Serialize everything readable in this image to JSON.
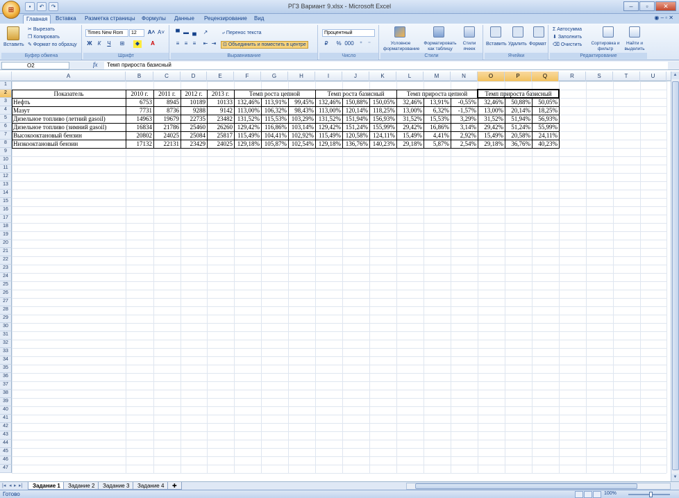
{
  "app": {
    "window_title": "РГЗ Вариант 9.xlsx - Microsoft Excel",
    "office_button_icon": "office-logo-icon",
    "qat": [
      "save-icon",
      "undo-icon",
      "redo-icon"
    ],
    "window_controls": [
      "–",
      "▫",
      "✕"
    ]
  },
  "ribbon": {
    "tabs": [
      "Главная",
      "Вставка",
      "Разметка страницы",
      "Формулы",
      "Данные",
      "Рецензирование",
      "Вид"
    ],
    "active_tab": "Главная",
    "clipboard": {
      "paste": "Вставить",
      "cut": "Вырезать",
      "copy": "Копировать",
      "format_painter": "Формат по образцу",
      "label": "Буфер обмена"
    },
    "font": {
      "name": "Times New Rom",
      "size": "12",
      "bold": "Ж",
      "italic": "К",
      "underline": "Ч",
      "label": "Шрифт"
    },
    "alignment": {
      "wrap": "Перенос текста",
      "merge": "Объединить и поместить в центре",
      "label": "Выравнивание"
    },
    "number": {
      "format": "Процентный",
      "percent": "%",
      "thousands": "000",
      "label": "Число"
    },
    "styles": {
      "conditional": "Условное форматирование",
      "as_table": "Форматировать как таблицу",
      "cell_styles": "Стили ячеек",
      "label": "Стили"
    },
    "cells": {
      "insert": "Вставить",
      "delete": "Удалить",
      "format": "Формат",
      "label": "Ячейки"
    },
    "editing": {
      "autosum": "Автосумма",
      "fill": "Заполнить",
      "clear": "Очистить",
      "sort": "Сортировка и фильтр",
      "find": "Найти и выделить",
      "label": "Редактирование"
    }
  },
  "formula_bar": {
    "name_box": "O2",
    "fx": "fx",
    "content": "Темп прироста базисный"
  },
  "columns": [
    "A",
    "B",
    "C",
    "D",
    "E",
    "F",
    "G",
    "H",
    "I",
    "J",
    "K",
    "L",
    "M",
    "N",
    "O",
    "P",
    "Q",
    "R",
    "S",
    "T",
    "U"
  ],
  "selected_columns": [
    "O",
    "P",
    "Q"
  ],
  "row_count": 47,
  "sheet": {
    "header_row": {
      "A": "Показатель",
      "B": "2010 г.",
      "C": "2011 г.",
      "D": "2012 г.",
      "E": "2013 г.",
      "FH": "Темп роста цепной",
      "IK": "Темп роста базисный",
      "LN": "Темп прироста цепной",
      "OQ": "Темп прироста базисный"
    },
    "rows": [
      {
        "name": "Нефть",
        "vals": [
          "6753",
          "8945",
          "10189",
          "10133",
          "132,46%",
          "113,91%",
          "99,45%",
          "132,46%",
          "150,88%",
          "150,05%",
          "32,46%",
          "13,91%",
          "-0,55%",
          "32,46%",
          "50,88%",
          "50,05%"
        ]
      },
      {
        "name": "Мазут",
        "vals": [
          "7731",
          "8736",
          "9288",
          "9142",
          "113,00%",
          "106,32%",
          "98,43%",
          "113,00%",
          "120,14%",
          "118,25%",
          "13,00%",
          "6,32%",
          "-1,57%",
          "13,00%",
          "20,14%",
          "18,25%"
        ]
      },
      {
        "name": "Дизельное топливо (летний gasoil)",
        "vals": [
          "14963",
          "19679",
          "22735",
          "23482",
          "131,52%",
          "115,53%",
          "103,29%",
          "131,52%",
          "151,94%",
          "156,93%",
          "31,52%",
          "15,53%",
          "3,29%",
          "31,52%",
          "51,94%",
          "56,93%"
        ]
      },
      {
        "name": "Дизельное топливо (зимний gasoil)",
        "vals": [
          "16834",
          "21786",
          "25460",
          "26260",
          "129,42%",
          "116,86%",
          "103,14%",
          "129,42%",
          "151,24%",
          "155,99%",
          "29,42%",
          "16,86%",
          "3,14%",
          "29,42%",
          "51,24%",
          "55,99%"
        ]
      },
      {
        "name": "Высокооктановый бензин",
        "vals": [
          "20802",
          "24025",
          "25084",
          "25817",
          "115,49%",
          "104,41%",
          "102,92%",
          "115,49%",
          "120,58%",
          "124,11%",
          "15,49%",
          "4,41%",
          "2,92%",
          "15,49%",
          "20,58%",
          "24,11%"
        ]
      },
      {
        "name": "Низкооктановый бензин",
        "vals": [
          "17132",
          "22131",
          "23429",
          "24025",
          "129,18%",
          "105,87%",
          "102,54%",
          "129,18%",
          "136,76%",
          "140,23%",
          "29,18%",
          "5,87%",
          "2,54%",
          "29,18%",
          "36,76%",
          "40,23%"
        ]
      }
    ]
  },
  "sheet_tabs": [
    "Задание 1",
    "Задание 2",
    "Задание 3",
    "Задание 4"
  ],
  "active_sheet": "Задание 1",
  "status": {
    "ready": "Готово",
    "zoom": "100%"
  }
}
